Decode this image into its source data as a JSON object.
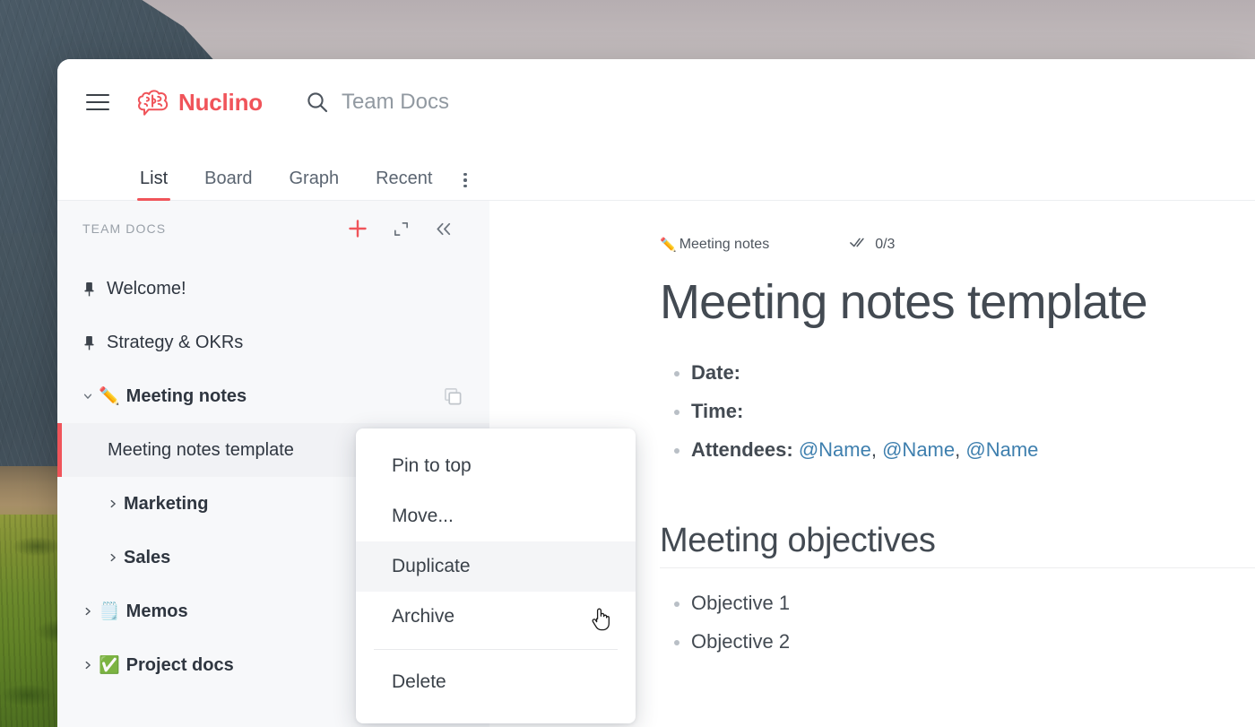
{
  "app": {
    "brand_name": "Nuclino",
    "brand_logo_icon": "brain-speech-bubble-icon",
    "menu_icon": "hamburger-menu-icon",
    "accent_color": "#F0545A",
    "text_color": "#434A52",
    "link_color": "#3E7FAE"
  },
  "search": {
    "icon": "search-icon",
    "value": "Team Docs"
  },
  "tabs": {
    "items": [
      {
        "label": "List",
        "active": true
      },
      {
        "label": "Board",
        "active": false
      },
      {
        "label": "Graph",
        "active": false
      },
      {
        "label": "Recent",
        "active": false
      }
    ],
    "more_icon": "overflow-menu-vertical-icon"
  },
  "sidebar": {
    "title": "TEAM DOCS",
    "actions": [
      {
        "name": "add-item-button",
        "icon": "plus-icon",
        "color": "#F0545A"
      },
      {
        "name": "expand-button",
        "icon": "expand-corners-icon"
      },
      {
        "name": "collapse-sidebar-button",
        "icon": "chevron-double-left-icon"
      }
    ],
    "items": [
      {
        "label": "Welcome!",
        "icon": "pin-icon",
        "indent": 0,
        "bold": false,
        "caret": "",
        "selected": false
      },
      {
        "label": "Strategy & OKRs",
        "icon": "pin-icon",
        "indent": 0,
        "bold": false,
        "caret": "",
        "selected": false
      },
      {
        "label": "Meeting notes",
        "emoji": "✏️",
        "indent": 0,
        "bold": true,
        "caret": "down",
        "selected": false,
        "trailing_icon": "duplicate-icon"
      },
      {
        "label": "Meeting notes template",
        "indent": 1,
        "bold": false,
        "caret": "",
        "selected": true
      },
      {
        "label": "Marketing",
        "indent": 1,
        "bold": true,
        "caret": "right",
        "selected": false
      },
      {
        "label": "Sales",
        "indent": 1,
        "bold": true,
        "caret": "right",
        "selected": false
      },
      {
        "label": "Memos",
        "emoji": "🗒️",
        "indent": 0,
        "bold": true,
        "caret": "right",
        "selected": false
      },
      {
        "label": "Project docs",
        "emoji": "✅",
        "indent": 0,
        "bold": true,
        "caret": "right",
        "selected": false
      }
    ]
  },
  "context_menu": {
    "items": [
      {
        "label": "Pin to top",
        "hovered": false,
        "divider_before": false
      },
      {
        "label": "Move...",
        "hovered": false,
        "divider_before": false
      },
      {
        "label": "Duplicate",
        "hovered": true,
        "divider_before": false
      },
      {
        "label": "Archive",
        "hovered": false,
        "divider_before": false
      },
      {
        "label": "Delete",
        "hovered": false,
        "divider_before": true
      }
    ]
  },
  "document": {
    "breadcrumb_emoji": "✏️",
    "breadcrumb_label": "Meeting notes",
    "progress_icon": "double-check-icon",
    "progress_label": "0/3",
    "title": "Meeting notes template",
    "top_list": [
      {
        "bold_prefix": "Date:",
        "rest": ""
      },
      {
        "bold_prefix": "Time:",
        "rest": ""
      },
      {
        "bold_prefix": "Attendees:",
        "mentions": [
          "@Name",
          "@Name",
          "@Name"
        ]
      }
    ],
    "section_heading": "Meeting objectives",
    "objectives": [
      "Objective 1",
      "Objective 2"
    ]
  },
  "cursor": {
    "icon": "pointing-hand-cursor"
  }
}
